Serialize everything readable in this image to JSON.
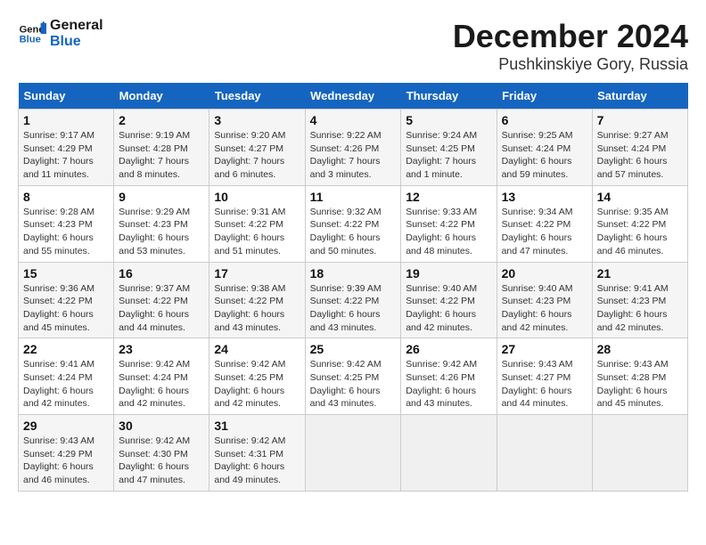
{
  "header": {
    "logo_line1": "General",
    "logo_line2": "Blue",
    "month": "December 2024",
    "location": "Pushkinskiye Gory, Russia"
  },
  "weekdays": [
    "Sunday",
    "Monday",
    "Tuesday",
    "Wednesday",
    "Thursday",
    "Friday",
    "Saturday"
  ],
  "weeks": [
    [
      {
        "day": "1",
        "info": "Sunrise: 9:17 AM\nSunset: 4:29 PM\nDaylight: 7 hours\nand 11 minutes."
      },
      {
        "day": "2",
        "info": "Sunrise: 9:19 AM\nSunset: 4:28 PM\nDaylight: 7 hours\nand 8 minutes."
      },
      {
        "day": "3",
        "info": "Sunrise: 9:20 AM\nSunset: 4:27 PM\nDaylight: 7 hours\nand 6 minutes."
      },
      {
        "day": "4",
        "info": "Sunrise: 9:22 AM\nSunset: 4:26 PM\nDaylight: 7 hours\nand 3 minutes."
      },
      {
        "day": "5",
        "info": "Sunrise: 9:24 AM\nSunset: 4:25 PM\nDaylight: 7 hours\nand 1 minute."
      },
      {
        "day": "6",
        "info": "Sunrise: 9:25 AM\nSunset: 4:24 PM\nDaylight: 6 hours\nand 59 minutes."
      },
      {
        "day": "7",
        "info": "Sunrise: 9:27 AM\nSunset: 4:24 PM\nDaylight: 6 hours\nand 57 minutes."
      }
    ],
    [
      {
        "day": "8",
        "info": "Sunrise: 9:28 AM\nSunset: 4:23 PM\nDaylight: 6 hours\nand 55 minutes."
      },
      {
        "day": "9",
        "info": "Sunrise: 9:29 AM\nSunset: 4:23 PM\nDaylight: 6 hours\nand 53 minutes."
      },
      {
        "day": "10",
        "info": "Sunrise: 9:31 AM\nSunset: 4:22 PM\nDaylight: 6 hours\nand 51 minutes."
      },
      {
        "day": "11",
        "info": "Sunrise: 9:32 AM\nSunset: 4:22 PM\nDaylight: 6 hours\nand 50 minutes."
      },
      {
        "day": "12",
        "info": "Sunrise: 9:33 AM\nSunset: 4:22 PM\nDaylight: 6 hours\nand 48 minutes."
      },
      {
        "day": "13",
        "info": "Sunrise: 9:34 AM\nSunset: 4:22 PM\nDaylight: 6 hours\nand 47 minutes."
      },
      {
        "day": "14",
        "info": "Sunrise: 9:35 AM\nSunset: 4:22 PM\nDaylight: 6 hours\nand 46 minutes."
      }
    ],
    [
      {
        "day": "15",
        "info": "Sunrise: 9:36 AM\nSunset: 4:22 PM\nDaylight: 6 hours\nand 45 minutes."
      },
      {
        "day": "16",
        "info": "Sunrise: 9:37 AM\nSunset: 4:22 PM\nDaylight: 6 hours\nand 44 minutes."
      },
      {
        "day": "17",
        "info": "Sunrise: 9:38 AM\nSunset: 4:22 PM\nDaylight: 6 hours\nand 43 minutes."
      },
      {
        "day": "18",
        "info": "Sunrise: 9:39 AM\nSunset: 4:22 PM\nDaylight: 6 hours\nand 43 minutes."
      },
      {
        "day": "19",
        "info": "Sunrise: 9:40 AM\nSunset: 4:22 PM\nDaylight: 6 hours\nand 42 minutes."
      },
      {
        "day": "20",
        "info": "Sunrise: 9:40 AM\nSunset: 4:23 PM\nDaylight: 6 hours\nand 42 minutes."
      },
      {
        "day": "21",
        "info": "Sunrise: 9:41 AM\nSunset: 4:23 PM\nDaylight: 6 hours\nand 42 minutes."
      }
    ],
    [
      {
        "day": "22",
        "info": "Sunrise: 9:41 AM\nSunset: 4:24 PM\nDaylight: 6 hours\nand 42 minutes."
      },
      {
        "day": "23",
        "info": "Sunrise: 9:42 AM\nSunset: 4:24 PM\nDaylight: 6 hours\nand 42 minutes."
      },
      {
        "day": "24",
        "info": "Sunrise: 9:42 AM\nSunset: 4:25 PM\nDaylight: 6 hours\nand 42 minutes."
      },
      {
        "day": "25",
        "info": "Sunrise: 9:42 AM\nSunset: 4:25 PM\nDaylight: 6 hours\nand 43 minutes."
      },
      {
        "day": "26",
        "info": "Sunrise: 9:42 AM\nSunset: 4:26 PM\nDaylight: 6 hours\nand 43 minutes."
      },
      {
        "day": "27",
        "info": "Sunrise: 9:43 AM\nSunset: 4:27 PM\nDaylight: 6 hours\nand 44 minutes."
      },
      {
        "day": "28",
        "info": "Sunrise: 9:43 AM\nSunset: 4:28 PM\nDaylight: 6 hours\nand 45 minutes."
      }
    ],
    [
      {
        "day": "29",
        "info": "Sunrise: 9:43 AM\nSunset: 4:29 PM\nDaylight: 6 hours\nand 46 minutes."
      },
      {
        "day": "30",
        "info": "Sunrise: 9:42 AM\nSunset: 4:30 PM\nDaylight: 6 hours\nand 47 minutes."
      },
      {
        "day": "31",
        "info": "Sunrise: 9:42 AM\nSunset: 4:31 PM\nDaylight: 6 hours\nand 49 minutes."
      },
      {
        "day": "",
        "info": ""
      },
      {
        "day": "",
        "info": ""
      },
      {
        "day": "",
        "info": ""
      },
      {
        "day": "",
        "info": ""
      }
    ]
  ]
}
